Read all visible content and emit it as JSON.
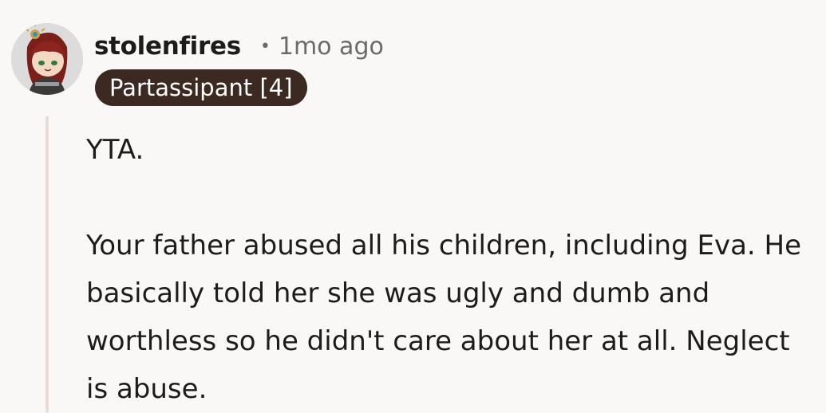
{
  "comment": {
    "author": "stolenfires",
    "separator": "•",
    "timestamp": "1mo ago",
    "flair": "Partassipant [4]",
    "paragraphs": [
      "YTA.",
      "Your father abused all his children, including Eva. He basically told her she was ugly and dumb and worthless so he didn't care about her at all. Neglect is abuse."
    ]
  },
  "colors": {
    "background": "#faf8f6",
    "flair_background": "#3c2a22",
    "thread_line": "#e8dcd4",
    "meta_text": "#6a6a6a"
  },
  "avatar": {
    "icon": "avatar-icon"
  }
}
